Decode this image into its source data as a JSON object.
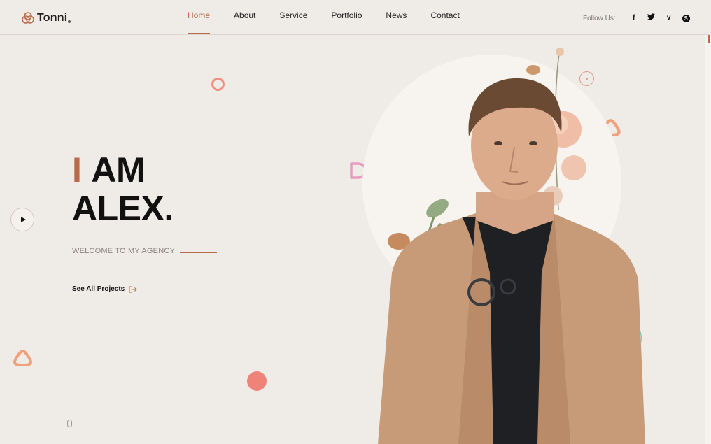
{
  "header": {
    "logo_text": "Tonni",
    "nav": [
      {
        "label": "Home",
        "active": true
      },
      {
        "label": "About",
        "active": false
      },
      {
        "label": "Service",
        "active": false
      },
      {
        "label": "Portfolio",
        "active": false
      },
      {
        "label": "News",
        "active": false
      },
      {
        "label": "Contact",
        "active": false
      }
    ],
    "follow_label": "Follow Us:",
    "social": [
      {
        "icon": "facebook-icon",
        "glyph": "f"
      },
      {
        "icon": "twitter-icon",
        "glyph": "🐦"
      },
      {
        "icon": "vimeo-icon",
        "glyph": "v"
      },
      {
        "icon": "skype-icon",
        "glyph": "S"
      }
    ]
  },
  "hero": {
    "title_accent": "I",
    "title_line1": "AM",
    "title_line2": "ALEX.",
    "subtitle": "WELCOME TO MY AGENCY",
    "cta_label": "See All Projects"
  },
  "colors": {
    "background": "#efebe6",
    "accent": "#b86a4a",
    "coral": "#ef8379",
    "teal": "#5bd6b8",
    "pink": "#e79bc2",
    "peach": "#f0a07a"
  }
}
